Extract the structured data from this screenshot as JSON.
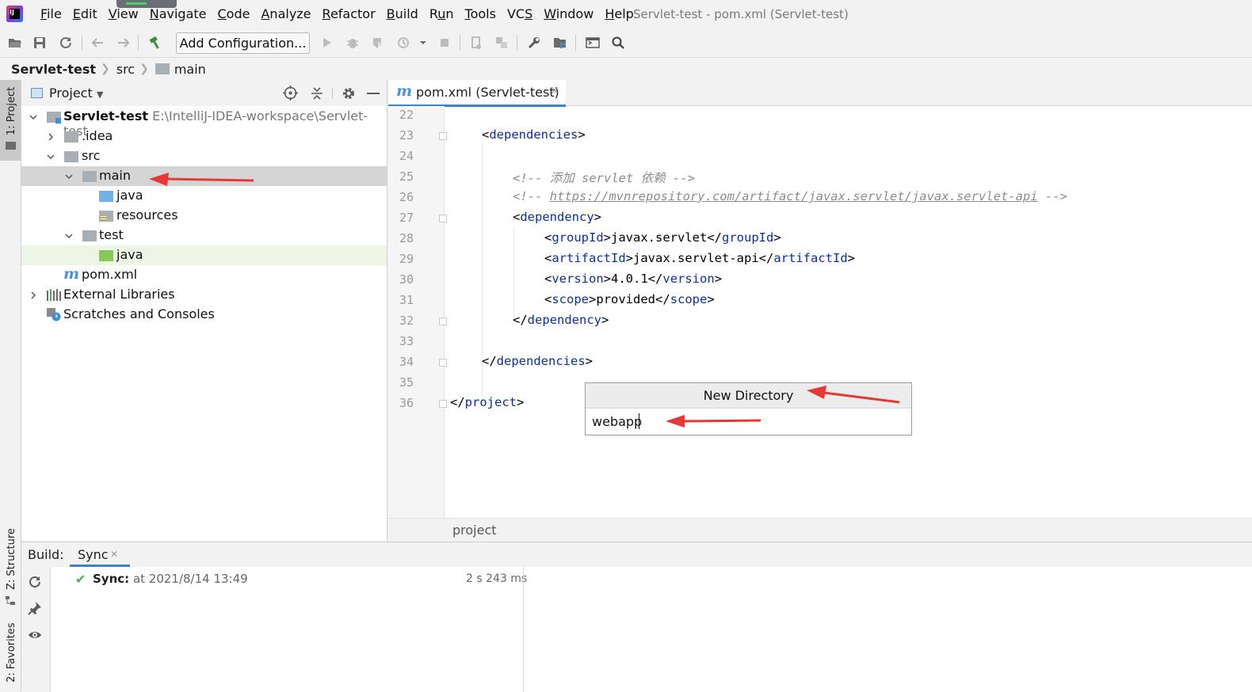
{
  "menubar": {
    "logo": "IJ",
    "items": [
      "File",
      "Edit",
      "View",
      "Navigate",
      "Code",
      "Analyze",
      "Refactor",
      "Build",
      "Run",
      "Tools",
      "VCS",
      "Window",
      "Help"
    ],
    "mnemonics": [
      "F",
      "E",
      "V",
      "N",
      "C",
      "A",
      "R",
      "B",
      "u",
      "T",
      "S",
      "W",
      "H"
    ],
    "window_title": "Servlet-test - pom.xml (Servlet-test)"
  },
  "toolbar": {
    "add_configuration": "Add Configuration..."
  },
  "breadcrumb": [
    "Servlet-test",
    "src",
    "main"
  ],
  "stripe": {
    "project": "1: Project",
    "structure": "Z: Structure",
    "favorites": "2: Favorites"
  },
  "project": {
    "header": "Project",
    "tree": [
      {
        "label": "Servlet-test",
        "path": "E:\\IntelliJ-IDEA-workspace\\Servlet-test"
      },
      {
        "label": ".idea"
      },
      {
        "label": "src"
      },
      {
        "label": "main"
      },
      {
        "label": "java"
      },
      {
        "label": "resources"
      },
      {
        "label": "test"
      },
      {
        "label": "java"
      },
      {
        "label": "pom.xml"
      },
      {
        "label": "External Libraries"
      },
      {
        "label": "Scratches and Consoles"
      }
    ]
  },
  "editor": {
    "tab_label": "pom.xml (Servlet-test)",
    "line_numbers": [
      "22",
      "23",
      "24",
      "25",
      "26",
      "27",
      "28",
      "29",
      "30",
      "31",
      "32",
      "33",
      "34",
      "35",
      "36"
    ],
    "code": {
      "dependencies_open": "dependencies",
      "comment1": "<!-- 添加 servlet 依赖 -->",
      "comment2_prefix": "<!-- ",
      "comment2_link": "https://mvnrepository.com/artifact/javax.servlet/javax.servlet-api",
      "comment2_suffix": " -->",
      "dependency": "dependency",
      "groupId_tag": "groupId",
      "groupId": "javax.servlet",
      "artifactId_tag": "artifactId",
      "artifactId": "javax.servlet-api",
      "version_tag": "version",
      "version": "4.0.1",
      "scope_tag": "scope",
      "scope": "provided",
      "project": "project"
    },
    "status_breadcrumb": "project"
  },
  "new_directory": {
    "title": "New Directory",
    "value": "webapp"
  },
  "build": {
    "label": "Build:",
    "tab": "Sync",
    "sync_label": "Sync:",
    "sync_time": "at 2021/8/14 13:49",
    "duration": "2 s 243 ms"
  },
  "colors": {
    "accent": "#4083c9",
    "selection": "#d5d5d5",
    "annotation_arrow": "#e53935",
    "xml_tag": "#0b2fa1",
    "success": "#4caf50"
  }
}
